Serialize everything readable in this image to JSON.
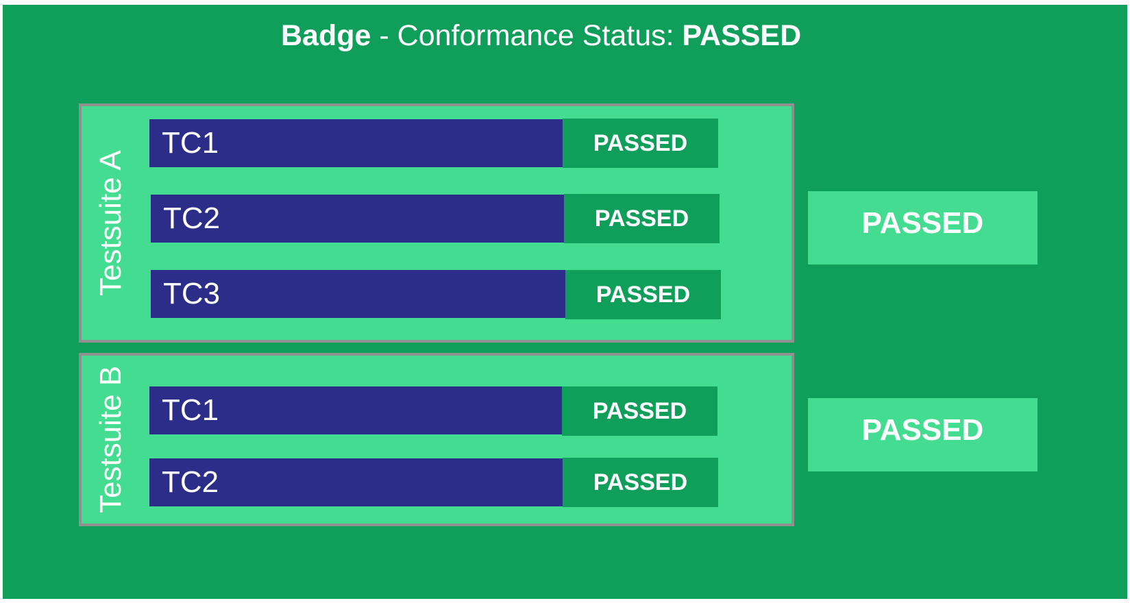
{
  "badge": {
    "title_bold": "Badge",
    "title_middle": " - Conformance Status: ",
    "title_status": "PASSED"
  },
  "suites": [
    {
      "label": "Testsuite A",
      "result": "PASSED",
      "tests": [
        {
          "name": "TC1",
          "status": "PASSED"
        },
        {
          "name": "TC2",
          "status": "PASSED"
        },
        {
          "name": "TC3",
          "status": "PASSED"
        }
      ]
    },
    {
      "label": "Testsuite B",
      "result": "PASSED",
      "tests": [
        {
          "name": "TC1",
          "status": "PASSED"
        },
        {
          "name": "TC2",
          "status": "PASSED"
        }
      ]
    }
  ],
  "colors": {
    "badge_background": "#109f5b",
    "suite_background": "#43dc90",
    "testcase_background": "#2c2d89",
    "suite_border": "#909090",
    "text": "#ffffff"
  }
}
